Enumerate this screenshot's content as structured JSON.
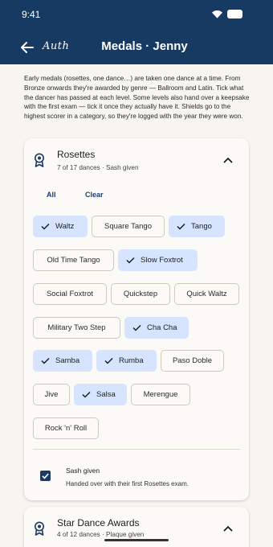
{
  "status": {
    "time": "9:41"
  },
  "header": {
    "logo": "Auth",
    "title": "Medals · Jenny"
  },
  "intro": "Early medals (rosettes, one dance…) are taken one dance at a time. From Bronze onwards they're awarded by genre — Ballroom and Latin. Tick what the dancer has passed at each level. Some levels also hand over a keepsake with the first exam — tick it once they actually have it. Shields go to the highest scorer in a category, so they're logged with the year they were won.",
  "rosettes": {
    "title": "Rosettes",
    "subtitle": "7 of 17 dances · Sash given",
    "all_label": "All",
    "clear_label": "Clear",
    "dances": [
      {
        "label": "Waltz",
        "selected": true
      },
      {
        "label": "Square Tango",
        "selected": false
      },
      {
        "label": "Tango",
        "selected": true
      },
      {
        "label": "Old Time Tango",
        "selected": false
      },
      {
        "label": "Slow Foxtrot",
        "selected": true
      },
      {
        "label": "Social Foxtrot",
        "selected": false
      },
      {
        "label": "Quickstep",
        "selected": false
      },
      {
        "label": "Quick Waltz",
        "selected": false
      },
      {
        "label": "Military Two Step",
        "selected": false
      },
      {
        "label": "Cha Cha",
        "selected": true
      },
      {
        "label": "Samba",
        "selected": true
      },
      {
        "label": "Rumba",
        "selected": true
      },
      {
        "label": "Paso Doble",
        "selected": false
      },
      {
        "label": "Jive",
        "selected": false
      },
      {
        "label": "Salsa",
        "selected": true
      },
      {
        "label": "Merengue",
        "selected": false
      },
      {
        "label": "Rock 'n' Roll",
        "selected": false
      }
    ],
    "keepsake": {
      "label": "Sash given",
      "description": "Handed over with their first Rosettes exam.",
      "checked": true
    }
  },
  "star_awards": {
    "title": "Star Dance Awards",
    "subtitle": "4 of 12 dances · Plaque given"
  },
  "colors": {
    "appbar": "#173a63",
    "chip_selected": "#d6e4ff",
    "background": "#f6f5f0"
  }
}
